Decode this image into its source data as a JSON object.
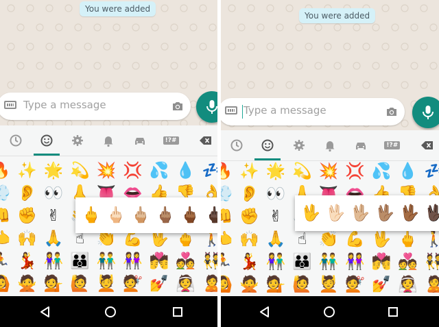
{
  "screens": [
    {
      "id": "left",
      "system_message": "You were added",
      "input": {
        "placeholder": "Type a message",
        "focused": false
      },
      "tabs": [
        {
          "name": "recent",
          "icon": "clock-icon"
        },
        {
          "name": "smileys",
          "icon": "smiley-icon",
          "active": true
        },
        {
          "name": "objects",
          "icon": "gear-icon"
        },
        {
          "name": "notifications",
          "icon": "bell-icon"
        },
        {
          "name": "travel",
          "icon": "car-icon"
        },
        {
          "name": "symbols",
          "icon": "symbols-icon",
          "label": "!?#"
        },
        {
          "name": "backspace",
          "icon": "backspace-icon"
        }
      ],
      "emoji_rows": [
        [
          "🔥",
          "✨",
          "🌟",
          "💫",
          "💥",
          "💢",
          "💦",
          "💧",
          "💤"
        ],
        [
          "💨",
          "👂",
          "👀",
          "👃",
          "👅",
          "👄",
          "👍",
          "👎",
          "👌"
        ],
        [
          "👊",
          "✊",
          "✌",
          "👋",
          "✋",
          "👐",
          "👆",
          "👇",
          "👉"
        ],
        [
          "👈",
          "🙌",
          "🙏",
          "☝",
          "👏",
          "💪",
          "🖖",
          "🖕",
          "🚶"
        ],
        [
          "🏃",
          "💃",
          "👫",
          "👪",
          "👬",
          "👭",
          "💏",
          "💑",
          "👯"
        ],
        [
          "🙆",
          "🙅",
          "💁",
          "🙋",
          "💆",
          "💇",
          "💅",
          "👰",
          "🙎"
        ]
      ],
      "skin_popup": {
        "for_emoji": "middle-finger",
        "variants": [
          "🖕",
          "🖕🏻",
          "🖕🏼",
          "🖕🏽",
          "🖕🏾",
          "🖕🏿"
        ],
        "colors": [
          "#f7c02e",
          "#f5d9c8",
          "#e2b894",
          "#c38d62",
          "#91613b",
          "#5a3a25"
        ]
      }
    },
    {
      "id": "right",
      "system_message": "You were added",
      "input": {
        "placeholder": "Type a message",
        "focused": true
      },
      "tabs": [
        {
          "name": "recent",
          "icon": "clock-icon"
        },
        {
          "name": "smileys",
          "icon": "smiley-icon",
          "active": true
        },
        {
          "name": "objects",
          "icon": "gear-icon"
        },
        {
          "name": "notifications",
          "icon": "bell-icon"
        },
        {
          "name": "travel",
          "icon": "car-icon"
        },
        {
          "name": "symbols",
          "icon": "symbols-icon",
          "label": "!?#"
        },
        {
          "name": "backspace",
          "icon": "backspace-icon"
        }
      ],
      "emoji_rows": [
        [
          "🔥",
          "✨",
          "🌟",
          "💫",
          "💥",
          "💢",
          "💦",
          "💧",
          "💤"
        ],
        [
          "💨",
          "👂",
          "👀",
          "👃",
          "👅",
          "👄",
          "👍",
          "👎",
          "👌"
        ],
        [
          "👊",
          "✊",
          "✌",
          "👋",
          "✋",
          "👐",
          "👆",
          "👇",
          "👉"
        ],
        [
          "👈",
          "🙌",
          "🙏",
          "☝",
          "👏",
          "💪",
          "🖖",
          "🖕",
          "🚶"
        ],
        [
          "🏃",
          "💃",
          "👫",
          "👪",
          "👬",
          "👭",
          "💏",
          "💑",
          "👯"
        ],
        [
          "🙆",
          "🙅",
          "💁",
          "🙋",
          "💆",
          "💇",
          "💅",
          "👰",
          "🙎"
        ]
      ],
      "skin_popup": {
        "for_emoji": "vulcan-salute",
        "variants": [
          "🖖",
          "🖖🏻",
          "🖖🏼",
          "🖖🏽",
          "🖖🏾",
          "🖖🏿"
        ],
        "colors": [
          "#f7c02e",
          "#f5d9c8",
          "#e2b894",
          "#c38d62",
          "#91613b",
          "#5a3a25"
        ]
      }
    }
  ],
  "nav": [
    {
      "name": "back",
      "icon": "back-triangle-icon"
    },
    {
      "name": "home",
      "icon": "home-circle-icon"
    },
    {
      "name": "recents",
      "icon": "recents-square-icon"
    }
  ],
  "colors": {
    "accent": "#128c7e",
    "chat_bg": "#ece5dd",
    "system_bubble": "#d5f1f8",
    "nav_bg": "#000000"
  }
}
